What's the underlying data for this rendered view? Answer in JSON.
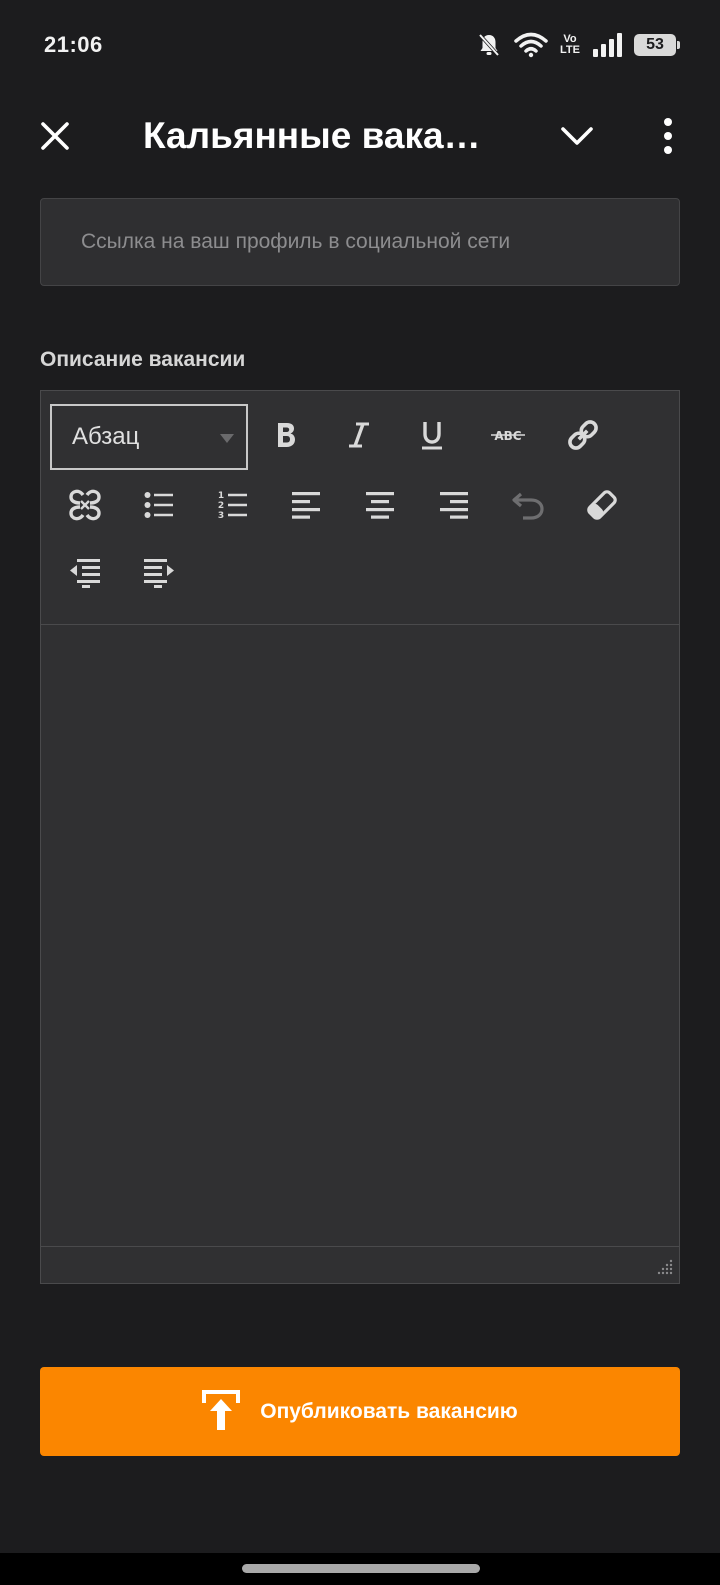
{
  "status_bar": {
    "time": "21:06",
    "volte_top": "Vo",
    "volte_bottom": "LTE",
    "battery": "53",
    "icons": [
      "bell-off-icon",
      "wifi-icon",
      "volte-icon",
      "signal-icon",
      "battery-icon"
    ]
  },
  "app_bar": {
    "title": "Кальянные вака…",
    "icons": [
      "close-icon",
      "chevron-down-icon",
      "more-vert-icon"
    ]
  },
  "social_link": {
    "placeholder": "Ссылка на ваш профиль в социальной сети",
    "value": ""
  },
  "description": {
    "label": "Описание вакансии",
    "format_select": "Абзац",
    "toolbar_icons": [
      "bold-icon",
      "italic-icon",
      "underline-icon",
      "strikethrough-icon",
      "link-icon",
      "unlink-icon",
      "bullet-list-icon",
      "numbered-list-icon",
      "align-left-icon",
      "align-center-icon",
      "align-right-icon",
      "undo-icon",
      "eraser-icon",
      "outdent-icon",
      "indent-icon"
    ],
    "content": ""
  },
  "publish_button": {
    "label": "Опубликовать вакансию",
    "icon": "upload-icon"
  },
  "colors": {
    "background": "#1c1c1e",
    "input_background": "#2f2f31",
    "editor_background": "#303032",
    "accent": "#fb8600"
  }
}
